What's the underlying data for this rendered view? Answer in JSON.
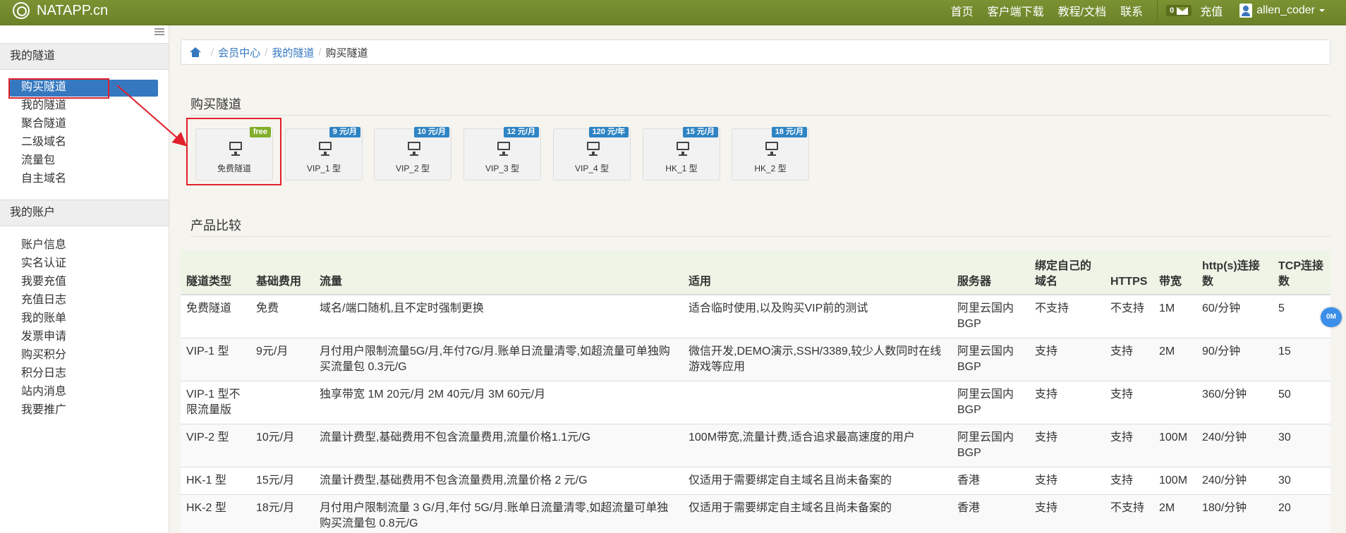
{
  "navbar": {
    "brand": "NATAPP.cn",
    "links": [
      "首页",
      "客户端下载",
      "教程/文档",
      "联系"
    ],
    "message_count": "0",
    "recharge": "充值",
    "username": "allen_coder"
  },
  "sidebar": {
    "sections": [
      {
        "title": "我的隧道",
        "items": [
          "购买隧道",
          "我的隧道",
          "聚合隧道",
          "二级域名",
          "流量包",
          "自主域名"
        ]
      },
      {
        "title": "我的账户",
        "items": [
          "账户信息",
          "实名认证",
          "我要充值",
          "充值日志",
          "我的账单",
          "发票申请",
          "购买积分",
          "积分日志",
          "站内消息",
          "我要推广"
        ]
      }
    ]
  },
  "breadcrumb": [
    "会员中心",
    "我的隧道",
    "购买隧道"
  ],
  "buy_section": {
    "title": "购买隧道",
    "plans": [
      {
        "name": "免费隧道",
        "tag": "free"
      },
      {
        "name": "VIP_1 型",
        "tag": "9 元/月"
      },
      {
        "name": "VIP_2 型",
        "tag": "10 元/月"
      },
      {
        "name": "VIP_3 型",
        "tag": "12 元/月"
      },
      {
        "name": "VIP_4 型",
        "tag": "120 元/年"
      },
      {
        "name": "HK_1 型",
        "tag": "15 元/月"
      },
      {
        "name": "HK_2 型",
        "tag": "18 元/月"
      }
    ]
  },
  "compare_section": {
    "title": "产品比较",
    "headers": [
      "隧道类型",
      "基础费用",
      "流量",
      "适用",
      "服务器",
      "绑定自己的域名",
      "HTTPS",
      "带宽",
      "http(s)连接数",
      "TCP连接数"
    ],
    "rows": [
      [
        "免费隧道",
        "免费",
        "域名/端口随机,且不定时强制更换",
        "适合临时使用,以及购买VIP前的测试",
        "阿里云国内BGP",
        "不支持",
        "不支持",
        "1M",
        "60/分钟",
        "5"
      ],
      [
        "VIP-1 型",
        "9元/月",
        "月付用户限制流量5G/月,年付7G/月.账单日流量清零,如超流量可单独购买流量包 0.3元/G",
        "微信开发,DEMO演示,SSH/3389,较少人数同时在线游戏等应用",
        "阿里云国内BGP",
        "支持",
        "支持",
        "2M",
        "90/分钟",
        "15"
      ],
      [
        "VIP-1 型不限流量版",
        "",
        "独享带宽 1M 20元/月 2M 40元/月 3M 60元/月",
        "",
        "阿里云国内BGP",
        "支持",
        "支持",
        "",
        "360/分钟",
        "50"
      ],
      [
        "VIP-2 型",
        "10元/月",
        "流量计费型,基础费用不包含流量费用,流量价格1.1元/G",
        "100M带宽,流量计费,适合追求最高速度的用户",
        "阿里云国内BGP",
        "支持",
        "支持",
        "100M",
        "240/分钟",
        "30"
      ],
      [
        "HK-1 型",
        "15元/月",
        "流量计费型,基础费用不包含流量费用,流量价格 2 元/G",
        "仅适用于需要绑定自主域名且尚未备案的",
        "香港",
        "支持",
        "支持",
        "100M",
        "240/分钟",
        "30"
      ],
      [
        "HK-2 型",
        "18元/月",
        "月付用户限制流量 3 G/月,年付 5G/月.账单日流量清零,如超流量可单独购买流量包 0.8元/G",
        "仅适用于需要绑定自主域名且尚未备案的",
        "香港",
        "支持",
        "不支持",
        "2M",
        "180/分钟",
        "20"
      ]
    ]
  },
  "speed_badge": "0M",
  "colors": {
    "navbar": "#7a9232",
    "accent": "#3578c0",
    "highlight": "#e0212b",
    "free_tag": "#82af2b"
  }
}
